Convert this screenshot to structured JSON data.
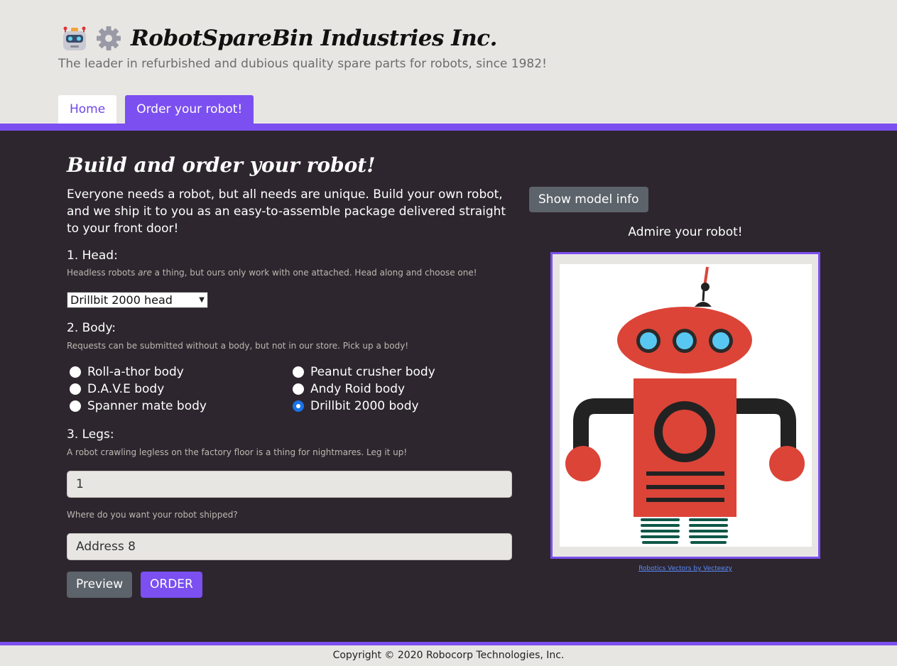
{
  "header": {
    "brand_title": "RobotSpareBin Industries Inc.",
    "tagline": "The leader in refurbished and dubious quality spare parts for robots, since 1982!",
    "tabs": [
      {
        "label": "Home"
      },
      {
        "label": "Order your robot!"
      }
    ]
  },
  "main": {
    "title": "Build and order your robot!",
    "intro": "Everyone needs a robot, but all needs are unique. Build your own robot, and we ship it to you as an easy-to-assemble package delivered straight to your front door!",
    "head": {
      "label": "1. Head:",
      "hint_before": "Headless robots ",
      "hint_em": "are",
      "hint_after": " a thing, but ours only work with one attached. Head along and choose one!",
      "selected": "Drillbit 2000 head"
    },
    "body": {
      "label": "2. Body:",
      "hint": "Requests can be submitted without a body, but not in our store. Pick up a body!",
      "options": [
        {
          "label": "Roll-a-thor body",
          "checked": false
        },
        {
          "label": "D.A.V.E body",
          "checked": false
        },
        {
          "label": "Spanner mate body",
          "checked": false
        },
        {
          "label": "Peanut crusher body",
          "checked": false
        },
        {
          "label": "Andy Roid body",
          "checked": false
        },
        {
          "label": "Drillbit 2000 body",
          "checked": true
        }
      ]
    },
    "legs": {
      "label": "3. Legs:",
      "hint": "A robot crawling legless on the factory floor is a thing for nightmares. Leg it up!",
      "value": "1"
    },
    "address": {
      "hint": "Where do you want your robot shipped?",
      "value": "Address 8"
    },
    "buttons": {
      "preview": "Preview",
      "order": "ORDER"
    }
  },
  "preview_panel": {
    "model_info_button": "Show model info",
    "admire": "Admire your robot!",
    "credit": "Robotics Vectors by Vecteezy"
  },
  "footer": {
    "copyright": "Copyright © 2020 Robocorp Technologies, Inc."
  },
  "colors": {
    "accent": "#7b4ff0",
    "dark_bg": "#2d262e",
    "robot_red": "#dc4438",
    "eye_blue": "#58c8f2",
    "leg_green": "#0f5747"
  }
}
